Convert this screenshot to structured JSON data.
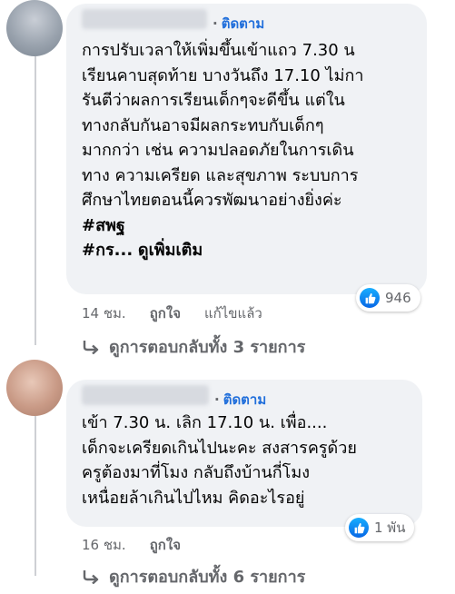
{
  "comments": [
    {
      "follow_label": "ติดตาม",
      "dot": "·",
      "lines": [
        "การปรับเวลาให้เพิ่มขึ้นเข้าแถว 7.30 น",
        "เรียนคาบสุดท้าย บางวันถึง 17.10 ไม่กา",
        "รันตีว่าผลการเรียนเด็กๆจะดีขึ้น แต่ใน",
        "ทางกลับกันอาจมีผลกระทบกับเด็กๆ",
        "มากกว่า เช่น ความปลอดภัยในการเดิน",
        "ทาง ความเครียด และสุขภาพ ระบบการ",
        "ศึกษาไทยตอนนี้ควรพัฒนาอย่างยิ่งค่ะ"
      ],
      "hashtag": "#สพฐ",
      "hashtag_partial": "#กร...",
      "see_more": "ดูเพิ่มเติม",
      "reaction_count": "946",
      "time": "14 ชม.",
      "like_label": "ถูกใจ",
      "edited_label": "แก้ไขแล้ว",
      "replies_label": "ดูการตอบกลับทั้ง 3 รายการ"
    },
    {
      "follow_label": "ติดตาม",
      "dot": "·",
      "lines": [
        "เข้า 7.30 น. เลิก 17.10 น. เพื่อ....",
        "เด็กจะเครียดเกินไปนะคะ สงสารครูด้วย",
        "ครูต้องมาที่โมง กลับถึงบ้านกี่โมง",
        "เหนื่อยล้าเกินไปไหม คิดอะไรอยู่"
      ],
      "reaction_count": "1 พัน",
      "time": "16 ชม.",
      "like_label": "ถูกใจ",
      "replies_label": "ดูการตอบกลับทั้ง 6 รายการ"
    }
  ],
  "colors": {
    "bubble": "#f0f2f5",
    "follow": "#216fdb",
    "meta": "#65676b",
    "like": "#0867e5"
  },
  "icons": {
    "like": "like-thumb-icon",
    "reply": "reply-arrow-icon"
  }
}
